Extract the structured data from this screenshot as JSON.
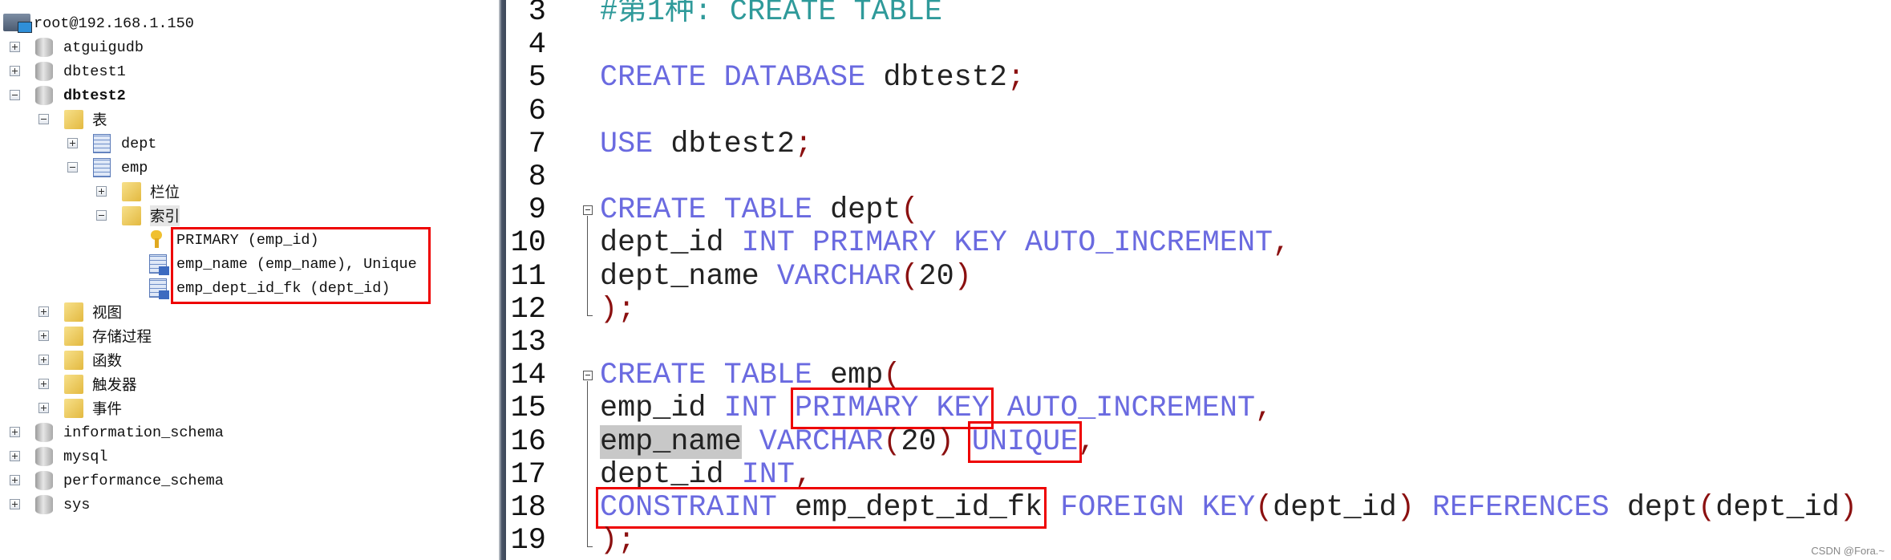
{
  "tree": {
    "items": [
      {
        "level": 0,
        "icon": "server-icon",
        "expander": "none",
        "label": "root@192.168.1.150"
      },
      {
        "level": 0,
        "icon": "database-icon",
        "expander": "plus",
        "label": "atguigudb"
      },
      {
        "level": 0,
        "icon": "database-icon",
        "expander": "plus",
        "label": "dbtest1"
      },
      {
        "level": 0,
        "icon": "database-icon",
        "expander": "minus",
        "label": "dbtest2",
        "bold": true
      },
      {
        "level": 1,
        "icon": "folder-icon",
        "expander": "minus",
        "label": "表"
      },
      {
        "level": 2,
        "icon": "table-icon",
        "expander": "plus",
        "label": "dept"
      },
      {
        "level": 2,
        "icon": "table-icon",
        "expander": "minus",
        "label": "emp"
      },
      {
        "level": 3,
        "icon": "folder-icon",
        "expander": "plus",
        "label": "栏位"
      },
      {
        "level": 3,
        "icon": "folder-icon",
        "expander": "minus",
        "label": "索引",
        "selected": true
      },
      {
        "level": 4,
        "icon": "key-icon",
        "expander": "none",
        "label": "PRIMARY (emp_id)"
      },
      {
        "level": 4,
        "icon": "index-icon",
        "expander": "none",
        "label": "emp_name (emp_name), Unique"
      },
      {
        "level": 4,
        "icon": "index-icon",
        "expander": "none",
        "label": "emp_dept_id_fk (dept_id)"
      },
      {
        "level": 1,
        "icon": "folder-icon",
        "expander": "plus",
        "label": "视图"
      },
      {
        "level": 1,
        "icon": "folder-icon",
        "expander": "plus",
        "label": "存储过程"
      },
      {
        "level": 1,
        "icon": "folder-icon",
        "expander": "plus",
        "label": "函数"
      },
      {
        "level": 1,
        "icon": "folder-icon",
        "expander": "plus",
        "label": "触发器"
      },
      {
        "level": 1,
        "icon": "folder-icon",
        "expander": "plus",
        "label": "事件"
      },
      {
        "level": 0,
        "icon": "database-icon",
        "expander": "plus",
        "label": "information_schema"
      },
      {
        "level": 0,
        "icon": "database-icon",
        "expander": "plus",
        "label": "mysql"
      },
      {
        "level": 0,
        "icon": "database-icon",
        "expander": "plus",
        "label": "performance_schema"
      },
      {
        "level": 0,
        "icon": "database-icon",
        "expander": "plus",
        "label": "sys"
      }
    ]
  },
  "editor": {
    "lines": [
      {
        "num": "3",
        "tokens": [
          {
            "t": "#第1种: CREATE TABLE",
            "c": "cm"
          }
        ]
      },
      {
        "num": "4",
        "tokens": []
      },
      {
        "num": "5",
        "tokens": [
          {
            "t": "CREATE DATABASE",
            "c": "kw"
          },
          {
            "t": " dbtest2"
          },
          {
            "t": ";",
            "c": "p"
          }
        ]
      },
      {
        "num": "6",
        "tokens": []
      },
      {
        "num": "7",
        "tokens": [
          {
            "t": "USE",
            "c": "kw"
          },
          {
            "t": " dbtest2"
          },
          {
            "t": ";",
            "c": "p"
          }
        ]
      },
      {
        "num": "8",
        "tokens": []
      },
      {
        "num": "9",
        "fold": "start",
        "tokens": [
          {
            "t": "CREATE TABLE",
            "c": "kw"
          },
          {
            "t": " dept"
          },
          {
            "t": "(",
            "c": "p"
          }
        ]
      },
      {
        "num": "10",
        "tokens": [
          {
            "t": "dept_id "
          },
          {
            "t": "INT PRIMARY KEY AUTO_INCREMENT",
            "c": "kw"
          },
          {
            "t": ",",
            "c": "p"
          }
        ]
      },
      {
        "num": "11",
        "tokens": [
          {
            "t": "dept_name "
          },
          {
            "t": "VARCHAR",
            "c": "kw"
          },
          {
            "t": "(",
            "c": "p"
          },
          {
            "t": "20"
          },
          {
            "t": ")",
            "c": "p"
          }
        ]
      },
      {
        "num": "12",
        "fold": "end",
        "tokens": [
          {
            "t": ");",
            "c": "p"
          }
        ]
      },
      {
        "num": "13",
        "tokens": []
      },
      {
        "num": "14",
        "fold": "start",
        "tokens": [
          {
            "t": "CREATE TABLE",
            "c": "kw"
          },
          {
            "t": " emp"
          },
          {
            "t": "(",
            "c": "p"
          }
        ]
      },
      {
        "num": "15",
        "tokens": [
          {
            "t": "emp_id "
          },
          {
            "t": "INT ",
            "c": "kw"
          },
          {
            "t": "PRIMARY KEY",
            "c": "kw box"
          },
          {
            "t": " AUTO_INCREMENT",
            "c": "kw"
          },
          {
            "t": ",",
            "c": "p"
          }
        ]
      },
      {
        "num": "16",
        "tokens": [
          {
            "t": "emp_name",
            "c": "hl"
          },
          {
            "t": " "
          },
          {
            "t": "VARCHAR",
            "c": "kw"
          },
          {
            "t": "(",
            "c": "p"
          },
          {
            "t": "20"
          },
          {
            "t": ")",
            "c": "p"
          },
          {
            "t": " "
          },
          {
            "t": "UNIQUE",
            "c": "kw box"
          },
          {
            "t": ",",
            "c": "p"
          }
        ]
      },
      {
        "num": "17",
        "tokens": [
          {
            "t": "dept_id "
          },
          {
            "t": "INT",
            "c": "kw"
          },
          {
            "t": ",",
            "c": "p"
          }
        ]
      },
      {
        "num": "18",
        "tokens": [
          {
            "t": "CONSTRAINT emp_dept_id_fk",
            "c": "box",
            "parts": [
              {
                "t": "CONSTRAINT",
                "c": "kw"
              },
              {
                "t": " emp_dept_id_fk"
              }
            ]
          },
          {
            "t": " "
          },
          {
            "t": "FOREIGN KEY",
            "c": "kw"
          },
          {
            "t": "(",
            "c": "p"
          },
          {
            "t": "dept_id"
          },
          {
            "t": ")",
            "c": "p"
          },
          {
            "t": " "
          },
          {
            "t": "REFERENCES",
            "c": "kw"
          },
          {
            "t": " dept"
          },
          {
            "t": "(",
            "c": "p"
          },
          {
            "t": "dept_id"
          },
          {
            "t": ")",
            "c": "p"
          }
        ]
      },
      {
        "num": "19",
        "fold": "end",
        "tokens": [
          {
            "t": ");",
            "c": "p"
          }
        ]
      }
    ]
  },
  "watermark": "CSDN @Fora.~",
  "colors": {
    "keyword": "#6a6ae0",
    "comment": "#2f9a9a",
    "punctuation": "#8b1010",
    "highlight_box": "#ee0000"
  }
}
